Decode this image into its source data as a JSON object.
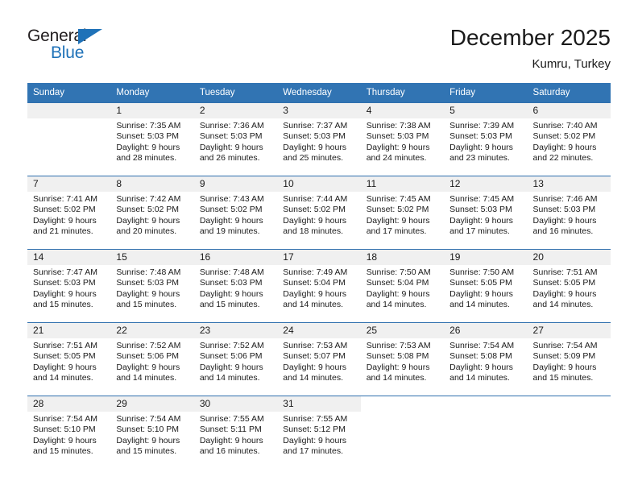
{
  "brand": {
    "name_part1": "General",
    "name_part2": "Blue",
    "triangle_color": "#1f72b8"
  },
  "header": {
    "title": "December 2025",
    "subtitle": "Kumru, Turkey",
    "header_bg": "#3174b3",
    "row_divider_color": "#2f6fae",
    "daynum_band_color": "#f0f0f0"
  },
  "weekday_headers": [
    "Sunday",
    "Monday",
    "Tuesday",
    "Wednesday",
    "Thursday",
    "Friday",
    "Saturday"
  ],
  "weeks": [
    [
      {
        "day": "",
        "sunrise": "",
        "sunset": "",
        "daylight_line1": "",
        "daylight_line2": "",
        "empty": true
      },
      {
        "day": "1",
        "sunrise": "Sunrise: 7:35 AM",
        "sunset": "Sunset: 5:03 PM",
        "daylight_line1": "Daylight: 9 hours",
        "daylight_line2": "and 28 minutes."
      },
      {
        "day": "2",
        "sunrise": "Sunrise: 7:36 AM",
        "sunset": "Sunset: 5:03 PM",
        "daylight_line1": "Daylight: 9 hours",
        "daylight_line2": "and 26 minutes."
      },
      {
        "day": "3",
        "sunrise": "Sunrise: 7:37 AM",
        "sunset": "Sunset: 5:03 PM",
        "daylight_line1": "Daylight: 9 hours",
        "daylight_line2": "and 25 minutes."
      },
      {
        "day": "4",
        "sunrise": "Sunrise: 7:38 AM",
        "sunset": "Sunset: 5:03 PM",
        "daylight_line1": "Daylight: 9 hours",
        "daylight_line2": "and 24 minutes."
      },
      {
        "day": "5",
        "sunrise": "Sunrise: 7:39 AM",
        "sunset": "Sunset: 5:03 PM",
        "daylight_line1": "Daylight: 9 hours",
        "daylight_line2": "and 23 minutes."
      },
      {
        "day": "6",
        "sunrise": "Sunrise: 7:40 AM",
        "sunset": "Sunset: 5:02 PM",
        "daylight_line1": "Daylight: 9 hours",
        "daylight_line2": "and 22 minutes."
      }
    ],
    [
      {
        "day": "7",
        "sunrise": "Sunrise: 7:41 AM",
        "sunset": "Sunset: 5:02 PM",
        "daylight_line1": "Daylight: 9 hours",
        "daylight_line2": "and 21 minutes."
      },
      {
        "day": "8",
        "sunrise": "Sunrise: 7:42 AM",
        "sunset": "Sunset: 5:02 PM",
        "daylight_line1": "Daylight: 9 hours",
        "daylight_line2": "and 20 minutes."
      },
      {
        "day": "9",
        "sunrise": "Sunrise: 7:43 AM",
        "sunset": "Sunset: 5:02 PM",
        "daylight_line1": "Daylight: 9 hours",
        "daylight_line2": "and 19 minutes."
      },
      {
        "day": "10",
        "sunrise": "Sunrise: 7:44 AM",
        "sunset": "Sunset: 5:02 PM",
        "daylight_line1": "Daylight: 9 hours",
        "daylight_line2": "and 18 minutes."
      },
      {
        "day": "11",
        "sunrise": "Sunrise: 7:45 AM",
        "sunset": "Sunset: 5:02 PM",
        "daylight_line1": "Daylight: 9 hours",
        "daylight_line2": "and 17 minutes."
      },
      {
        "day": "12",
        "sunrise": "Sunrise: 7:45 AM",
        "sunset": "Sunset: 5:03 PM",
        "daylight_line1": "Daylight: 9 hours",
        "daylight_line2": "and 17 minutes."
      },
      {
        "day": "13",
        "sunrise": "Sunrise: 7:46 AM",
        "sunset": "Sunset: 5:03 PM",
        "daylight_line1": "Daylight: 9 hours",
        "daylight_line2": "and 16 minutes."
      }
    ],
    [
      {
        "day": "14",
        "sunrise": "Sunrise: 7:47 AM",
        "sunset": "Sunset: 5:03 PM",
        "daylight_line1": "Daylight: 9 hours",
        "daylight_line2": "and 15 minutes."
      },
      {
        "day": "15",
        "sunrise": "Sunrise: 7:48 AM",
        "sunset": "Sunset: 5:03 PM",
        "daylight_line1": "Daylight: 9 hours",
        "daylight_line2": "and 15 minutes."
      },
      {
        "day": "16",
        "sunrise": "Sunrise: 7:48 AM",
        "sunset": "Sunset: 5:03 PM",
        "daylight_line1": "Daylight: 9 hours",
        "daylight_line2": "and 15 minutes."
      },
      {
        "day": "17",
        "sunrise": "Sunrise: 7:49 AM",
        "sunset": "Sunset: 5:04 PM",
        "daylight_line1": "Daylight: 9 hours",
        "daylight_line2": "and 14 minutes."
      },
      {
        "day": "18",
        "sunrise": "Sunrise: 7:50 AM",
        "sunset": "Sunset: 5:04 PM",
        "daylight_line1": "Daylight: 9 hours",
        "daylight_line2": "and 14 minutes."
      },
      {
        "day": "19",
        "sunrise": "Sunrise: 7:50 AM",
        "sunset": "Sunset: 5:05 PM",
        "daylight_line1": "Daylight: 9 hours",
        "daylight_line2": "and 14 minutes."
      },
      {
        "day": "20",
        "sunrise": "Sunrise: 7:51 AM",
        "sunset": "Sunset: 5:05 PM",
        "daylight_line1": "Daylight: 9 hours",
        "daylight_line2": "and 14 minutes."
      }
    ],
    [
      {
        "day": "21",
        "sunrise": "Sunrise: 7:51 AM",
        "sunset": "Sunset: 5:05 PM",
        "daylight_line1": "Daylight: 9 hours",
        "daylight_line2": "and 14 minutes."
      },
      {
        "day": "22",
        "sunrise": "Sunrise: 7:52 AM",
        "sunset": "Sunset: 5:06 PM",
        "daylight_line1": "Daylight: 9 hours",
        "daylight_line2": "and 14 minutes."
      },
      {
        "day": "23",
        "sunrise": "Sunrise: 7:52 AM",
        "sunset": "Sunset: 5:06 PM",
        "daylight_line1": "Daylight: 9 hours",
        "daylight_line2": "and 14 minutes."
      },
      {
        "day": "24",
        "sunrise": "Sunrise: 7:53 AM",
        "sunset": "Sunset: 5:07 PM",
        "daylight_line1": "Daylight: 9 hours",
        "daylight_line2": "and 14 minutes."
      },
      {
        "day": "25",
        "sunrise": "Sunrise: 7:53 AM",
        "sunset": "Sunset: 5:08 PM",
        "daylight_line1": "Daylight: 9 hours",
        "daylight_line2": "and 14 minutes."
      },
      {
        "day": "26",
        "sunrise": "Sunrise: 7:54 AM",
        "sunset": "Sunset: 5:08 PM",
        "daylight_line1": "Daylight: 9 hours",
        "daylight_line2": "and 14 minutes."
      },
      {
        "day": "27",
        "sunrise": "Sunrise: 7:54 AM",
        "sunset": "Sunset: 5:09 PM",
        "daylight_line1": "Daylight: 9 hours",
        "daylight_line2": "and 15 minutes."
      }
    ],
    [
      {
        "day": "28",
        "sunrise": "Sunrise: 7:54 AM",
        "sunset": "Sunset: 5:10 PM",
        "daylight_line1": "Daylight: 9 hours",
        "daylight_line2": "and 15 minutes."
      },
      {
        "day": "29",
        "sunrise": "Sunrise: 7:54 AM",
        "sunset": "Sunset: 5:10 PM",
        "daylight_line1": "Daylight: 9 hours",
        "daylight_line2": "and 15 minutes."
      },
      {
        "day": "30",
        "sunrise": "Sunrise: 7:55 AM",
        "sunset": "Sunset: 5:11 PM",
        "daylight_line1": "Daylight: 9 hours",
        "daylight_line2": "and 16 minutes."
      },
      {
        "day": "31",
        "sunrise": "Sunrise: 7:55 AM",
        "sunset": "Sunset: 5:12 PM",
        "daylight_line1": "Daylight: 9 hours",
        "daylight_line2": "and 17 minutes."
      },
      {
        "day": "",
        "sunrise": "",
        "sunset": "",
        "daylight_line1": "",
        "daylight_line2": "",
        "empty": true,
        "blank": true
      },
      {
        "day": "",
        "sunrise": "",
        "sunset": "",
        "daylight_line1": "",
        "daylight_line2": "",
        "empty": true,
        "blank": true
      },
      {
        "day": "",
        "sunrise": "",
        "sunset": "",
        "daylight_line1": "",
        "daylight_line2": "",
        "empty": true,
        "blank": true
      }
    ]
  ]
}
